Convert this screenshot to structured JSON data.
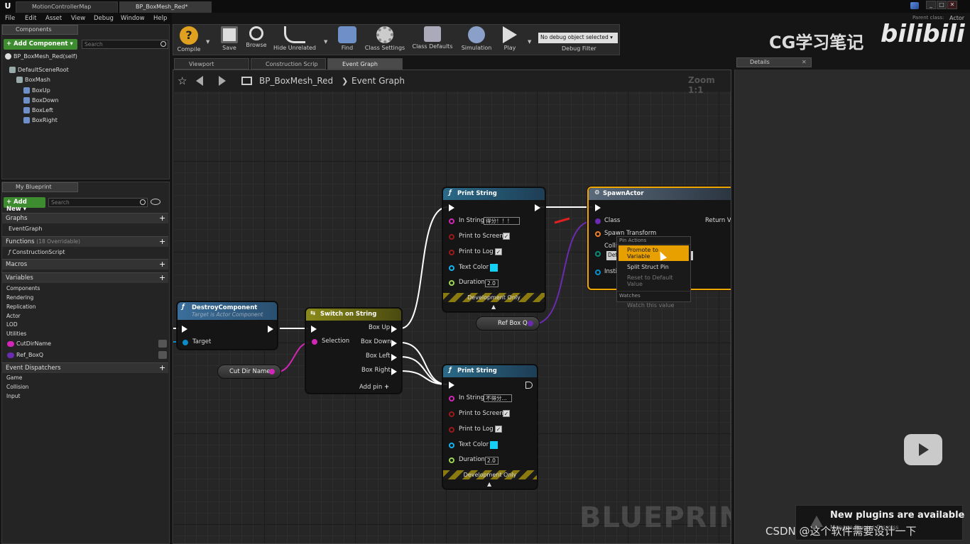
{
  "window": {
    "tabs": [
      {
        "label": "MotionControllerMap"
      },
      {
        "label": "BP_BoxMesh_Red*"
      }
    ],
    "parent_class_label": "Parent class:",
    "parent_class_value": "Actor",
    "controls": [
      "_",
      "□",
      "✕"
    ]
  },
  "menu": [
    "File",
    "Edit",
    "Asset",
    "View",
    "Debug",
    "Window",
    "Help"
  ],
  "components_panel": {
    "tab": "Components",
    "add_button": "+ Add Component ▾",
    "search_placeholder": "Search",
    "tree": [
      "BP_BoxMesh_Red(self)",
      "DefaultSceneRoot",
      "BoxMash",
      "BoxUp",
      "BoxDown",
      "BoxLeft",
      "BoxRight"
    ]
  },
  "my_blueprint": {
    "tab": "My Blueprint",
    "add_button": "+ Add New ▾",
    "search_placeholder": "Search",
    "graphs_label": "Graphs",
    "graph_items": [
      "EventGraph"
    ],
    "functions_label": "Functions",
    "functions_count": "(18 Overridable)",
    "function_items": [
      "ConstructionScript"
    ],
    "macros_label": "Macros",
    "variables_label": "Variables",
    "variable_categories": [
      "Components",
      "Rendering",
      "Replication",
      "Actor",
      "LOD",
      "Utilities"
    ],
    "variables": [
      {
        "name": "CutDirName",
        "color": "#d126b6"
      },
      {
        "name": "Ref_BoxQ",
        "color": "#6b2bb0"
      }
    ],
    "dispatchers_label": "Event Dispatchers",
    "dispatcher_categories": [
      "Game",
      "Collision",
      "Input"
    ]
  },
  "toolbar": {
    "compile": "Compile",
    "save": "Save",
    "browse": "Browse",
    "hide_unrelated": "Hide Unrelated",
    "find": "Find",
    "class_settings": "Class Settings",
    "class_defaults": "Class Defaults",
    "simulation": "Simulation",
    "play": "Play",
    "debug_select": "No debug object selected ▾",
    "debug_filter": "Debug Filter"
  },
  "graph_tabs": [
    "Viewport",
    "Construction Scrip",
    "Event Graph"
  ],
  "breadcrumb": {
    "root": "BP_BoxMesh_Red",
    "sep": "❯",
    "current": "Event Graph",
    "zoom": "Zoom 1:1"
  },
  "watermark": "BLUEPRINT",
  "nodes": {
    "destroy": {
      "title": "DestroyComponent",
      "subtitle": "Target is Actor Component",
      "target": "Target"
    },
    "switch": {
      "title": "Switch on String",
      "selection": "Selection",
      "outputs": [
        "Box Up",
        "Box Down",
        "Box Left",
        "Box Right"
      ],
      "add_pin": "Add pin"
    },
    "print1": {
      "title": "Print String",
      "in_string": "In String",
      "in_value": "得分！！！",
      "to_screen": "Print to Screen",
      "to_log": "Print to Log",
      "text_color": "Text Color",
      "duration": "Duration",
      "duration_value": "2.0",
      "dev_only": "Development Only"
    },
    "print2": {
      "title": "Print String",
      "in_string": "In String",
      "in_value": "不得分...",
      "to_screen": "Print to Screen",
      "to_log": "Print to Log",
      "text_color": "Text Color",
      "duration": "Duration",
      "duration_value": "2.0",
      "dev_only": "Development Only"
    },
    "spawn": {
      "title": "SpawnActor",
      "class": "Class",
      "spawn_transform": "Spawn Transform",
      "collision": "Collis",
      "collision_value": "Def",
      "instigator": "Instig",
      "return": "Return Va"
    },
    "cut_dir": {
      "label": "Cut Dir Name"
    },
    "ref_box": {
      "label": "Ref Box Q"
    }
  },
  "context_menu": {
    "section1": "Pin Actions",
    "items": [
      "Promote to Variable",
      "Split Struct Pin",
      "Reset to Default Value"
    ],
    "section2": "Watches",
    "watch": "Watch this value"
  },
  "details": {
    "tab": "Details"
  },
  "overlays": {
    "brand": "CG学习笔记",
    "logo": "bilibili",
    "notification": "New plugins are available",
    "notification_sub": "Manage Plugins  Dismiss",
    "csdn": "CSDN @这个软件需要设计一下"
  },
  "colors": {
    "exec": "#ffffff",
    "string": "#d126b6",
    "object": "#6b2bb0",
    "struct": "#f07d2d",
    "color": "#15b2f0",
    "float": "#9cd552",
    "bool": "#9a1a1a",
    "actor_ref": "#0a8dc8",
    "accent": "#f0a500"
  }
}
